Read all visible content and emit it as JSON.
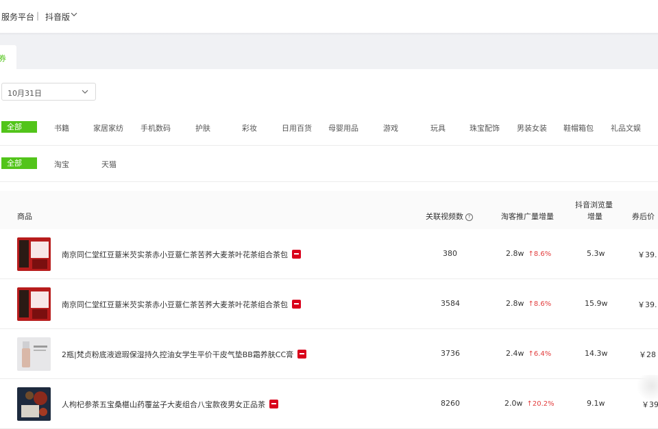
{
  "header": {
    "title": "服务平台",
    "separator": "|",
    "version": "抖音版"
  },
  "tabs": [
    {
      "label": "券",
      "active": true
    }
  ],
  "date_filter": {
    "value": "10月31日"
  },
  "category_filter": {
    "all_label": "全部",
    "items": [
      "书籍",
      "家居家纺",
      "手机数码",
      "护肤",
      "彩妆",
      "日用百货",
      "母婴用品",
      "游戏",
      "玩具",
      "珠宝配饰",
      "男装女装",
      "鞋帽箱包",
      "礼品文娱"
    ]
  },
  "platform_filter": {
    "all_label": "全部",
    "items": [
      "淘宝",
      "天猫"
    ]
  },
  "table": {
    "columns": {
      "product": "商品",
      "videos": "关联视频数",
      "promo": "淘客推广量增量",
      "views_line1": "抖音浏览量",
      "views_line2": "增量",
      "price": "券后价"
    },
    "rows": [
      {
        "name": "南京同仁堂红豆薏米芡实茶赤小豆薏仁茶苦荞大麦茶叶花茶组合茶包",
        "videos": "380",
        "promo": "2.8w",
        "promo_change": "↑8.6%",
        "views": "5.3w",
        "price": "￥39."
      },
      {
        "name": "南京同仁堂红豆薏米芡实茶赤小豆薏仁茶苦荞大麦茶叶花茶组合茶包",
        "videos": "3584",
        "promo": "2.8w",
        "promo_change": "↑8.6%",
        "views": "15.9w",
        "price": "￥39."
      },
      {
        "name": "2瓶|梵贞粉底液遮瑕保湿持久控油女学生平价干皮气垫BB霜养肤CC膏",
        "videos": "3736",
        "promo": "2.4w",
        "promo_change": "↑6.4%",
        "views": "14.3w",
        "price": "￥28"
      },
      {
        "name": "人枸杞参茶五宝桑椹山药覆盆子大麦组合八宝款夜男女正品茶",
        "videos": "8260",
        "promo": "2.0w",
        "promo_change": "↑20.2%",
        "views": "9.1w",
        "price": "￥39"
      }
    ]
  },
  "colors": {
    "accent_green": "#52c41a",
    "up_red": "#e23c3c",
    "tmall_red": "#d9001b"
  },
  "icons": [
    "chevron-down-icon",
    "help-icon",
    "tmall-badge-icon"
  ]
}
